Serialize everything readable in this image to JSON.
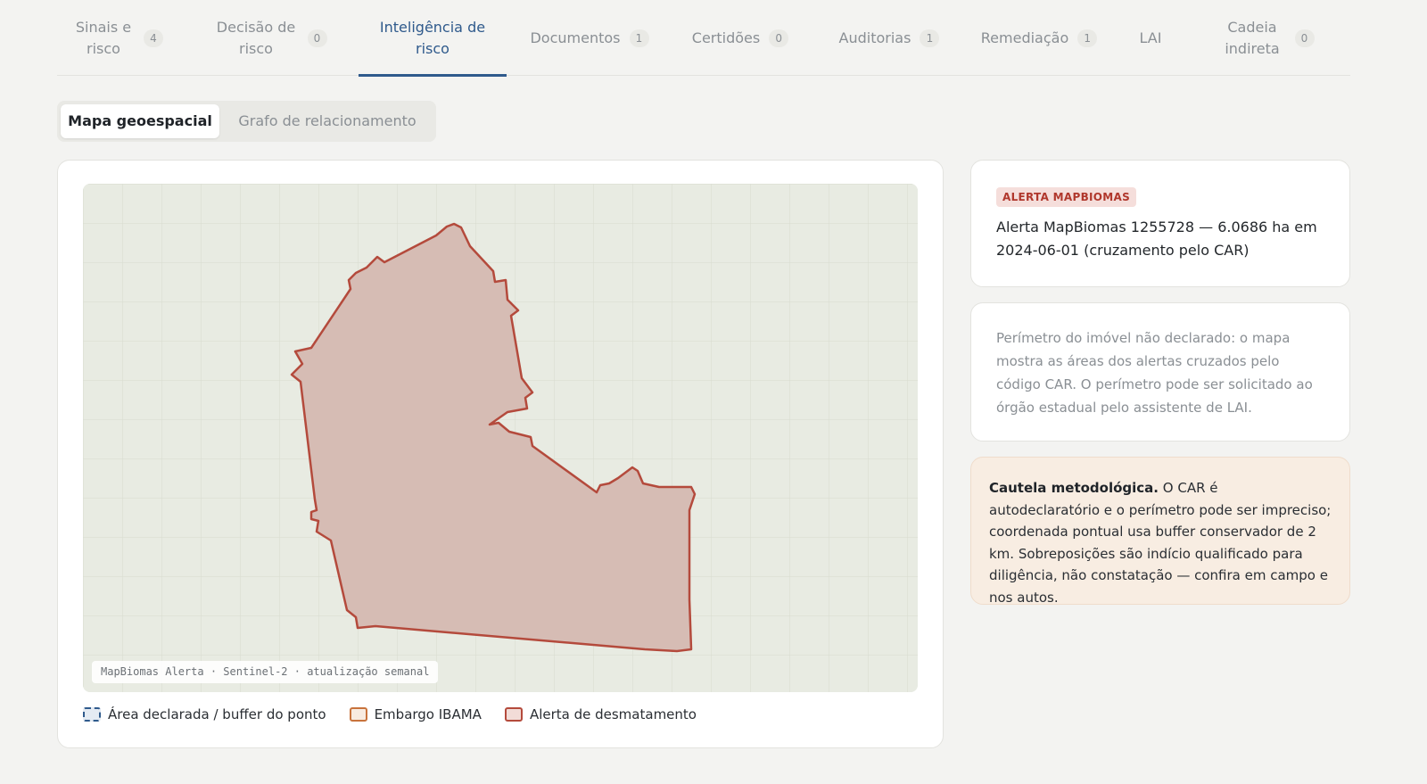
{
  "tabs": [
    {
      "label": "Sinais e risco",
      "count": "4"
    },
    {
      "label": "Decisão de risco",
      "count": "0"
    },
    {
      "label": "Inteligência de risco",
      "count": ""
    },
    {
      "label": "Documentos",
      "count": "1"
    },
    {
      "label": "Certidões",
      "count": "0"
    },
    {
      "label": "Auditorias",
      "count": "1"
    },
    {
      "label": "Remediação",
      "count": "1"
    },
    {
      "label": "LAI",
      "count": ""
    },
    {
      "label": "Cadeia indireta",
      "count": "0"
    }
  ],
  "active_tab": "Inteligência de risco",
  "view_toggle": {
    "map_label": "Mapa geoespacial",
    "graph_label": "Grafo de relacionamento",
    "selected": "Mapa geoespacial"
  },
  "map": {
    "attribution": "MapBiomas Alerta · Sentinel-2 · atualização semanal",
    "legend": {
      "declared": "Área declarada / buffer do ponto",
      "embargo": "Embargo IBAMA",
      "alert": "Alerta de desmatamento"
    }
  },
  "alert_card": {
    "badge": "ALERTA MAPBIOMAS",
    "text": "Alerta MapBiomas 1255728 — 6.0686 ha em 2024-06-01 (cruzamento pelo CAR)"
  },
  "perimeter_note": "Perímetro do imóvel não declarado: o mapa mostra as áreas dos alertas cruzados pelo código CAR. O perímetro pode ser solicitado ao órgão estadual pelo assistente de LAI.",
  "caution": {
    "title": "Cautela metodológica.",
    "text": " O CAR é autodeclaratório e o perímetro pode ser impreciso; coordenada pontual usa buffer conservador de 2 km. Sobreposições são indício qualificado para diligência, não constatação — confira em campo e nos autos."
  },
  "colors": {
    "accent": "#2f5a8c",
    "alert_stroke": "#b44a3c",
    "alert_fill": "#d6bcb4",
    "embargo": "#c8733c",
    "caution_bg": "#f8ede2"
  }
}
